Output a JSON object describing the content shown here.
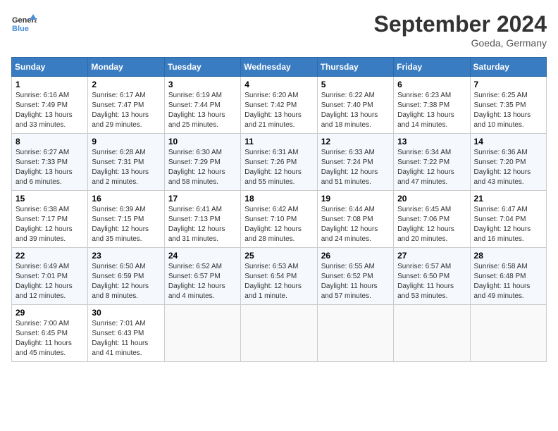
{
  "header": {
    "logo_text_top": "General",
    "logo_text_bottom": "Blue",
    "month_title": "September 2024",
    "location": "Goeda, Germany"
  },
  "days_of_week": [
    "Sunday",
    "Monday",
    "Tuesday",
    "Wednesday",
    "Thursday",
    "Friday",
    "Saturday"
  ],
  "weeks": [
    [
      {
        "day": "1",
        "sunrise": "6:16 AM",
        "sunset": "7:49 PM",
        "daylight": "13 hours and 33 minutes."
      },
      {
        "day": "2",
        "sunrise": "6:17 AM",
        "sunset": "7:47 PM",
        "daylight": "13 hours and 29 minutes."
      },
      {
        "day": "3",
        "sunrise": "6:19 AM",
        "sunset": "7:44 PM",
        "daylight": "13 hours and 25 minutes."
      },
      {
        "day": "4",
        "sunrise": "6:20 AM",
        "sunset": "7:42 PM",
        "daylight": "13 hours and 21 minutes."
      },
      {
        "day": "5",
        "sunrise": "6:22 AM",
        "sunset": "7:40 PM",
        "daylight": "13 hours and 18 minutes."
      },
      {
        "day": "6",
        "sunrise": "6:23 AM",
        "sunset": "7:38 PM",
        "daylight": "13 hours and 14 minutes."
      },
      {
        "day": "7",
        "sunrise": "6:25 AM",
        "sunset": "7:35 PM",
        "daylight": "13 hours and 10 minutes."
      }
    ],
    [
      {
        "day": "8",
        "sunrise": "6:27 AM",
        "sunset": "7:33 PM",
        "daylight": "13 hours and 6 minutes."
      },
      {
        "day": "9",
        "sunrise": "6:28 AM",
        "sunset": "7:31 PM",
        "daylight": "13 hours and 2 minutes."
      },
      {
        "day": "10",
        "sunrise": "6:30 AM",
        "sunset": "7:29 PM",
        "daylight": "12 hours and 58 minutes."
      },
      {
        "day": "11",
        "sunrise": "6:31 AM",
        "sunset": "7:26 PM",
        "daylight": "12 hours and 55 minutes."
      },
      {
        "day": "12",
        "sunrise": "6:33 AM",
        "sunset": "7:24 PM",
        "daylight": "12 hours and 51 minutes."
      },
      {
        "day": "13",
        "sunrise": "6:34 AM",
        "sunset": "7:22 PM",
        "daylight": "12 hours and 47 minutes."
      },
      {
        "day": "14",
        "sunrise": "6:36 AM",
        "sunset": "7:20 PM",
        "daylight": "12 hours and 43 minutes."
      }
    ],
    [
      {
        "day": "15",
        "sunrise": "6:38 AM",
        "sunset": "7:17 PM",
        "daylight": "12 hours and 39 minutes."
      },
      {
        "day": "16",
        "sunrise": "6:39 AM",
        "sunset": "7:15 PM",
        "daylight": "12 hours and 35 minutes."
      },
      {
        "day": "17",
        "sunrise": "6:41 AM",
        "sunset": "7:13 PM",
        "daylight": "12 hours and 31 minutes."
      },
      {
        "day": "18",
        "sunrise": "6:42 AM",
        "sunset": "7:10 PM",
        "daylight": "12 hours and 28 minutes."
      },
      {
        "day": "19",
        "sunrise": "6:44 AM",
        "sunset": "7:08 PM",
        "daylight": "12 hours and 24 minutes."
      },
      {
        "day": "20",
        "sunrise": "6:45 AM",
        "sunset": "7:06 PM",
        "daylight": "12 hours and 20 minutes."
      },
      {
        "day": "21",
        "sunrise": "6:47 AM",
        "sunset": "7:04 PM",
        "daylight": "12 hours and 16 minutes."
      }
    ],
    [
      {
        "day": "22",
        "sunrise": "6:49 AM",
        "sunset": "7:01 PM",
        "daylight": "12 hours and 12 minutes."
      },
      {
        "day": "23",
        "sunrise": "6:50 AM",
        "sunset": "6:59 PM",
        "daylight": "12 hours and 8 minutes."
      },
      {
        "day": "24",
        "sunrise": "6:52 AM",
        "sunset": "6:57 PM",
        "daylight": "12 hours and 4 minutes."
      },
      {
        "day": "25",
        "sunrise": "6:53 AM",
        "sunset": "6:54 PM",
        "daylight": "12 hours and 1 minute."
      },
      {
        "day": "26",
        "sunrise": "6:55 AM",
        "sunset": "6:52 PM",
        "daylight": "11 hours and 57 minutes."
      },
      {
        "day": "27",
        "sunrise": "6:57 AM",
        "sunset": "6:50 PM",
        "daylight": "11 hours and 53 minutes."
      },
      {
        "day": "28",
        "sunrise": "6:58 AM",
        "sunset": "6:48 PM",
        "daylight": "11 hours and 49 minutes."
      }
    ],
    [
      {
        "day": "29",
        "sunrise": "7:00 AM",
        "sunset": "6:45 PM",
        "daylight": "11 hours and 45 minutes."
      },
      {
        "day": "30",
        "sunrise": "7:01 AM",
        "sunset": "6:43 PM",
        "daylight": "11 hours and 41 minutes."
      },
      null,
      null,
      null,
      null,
      null
    ]
  ]
}
